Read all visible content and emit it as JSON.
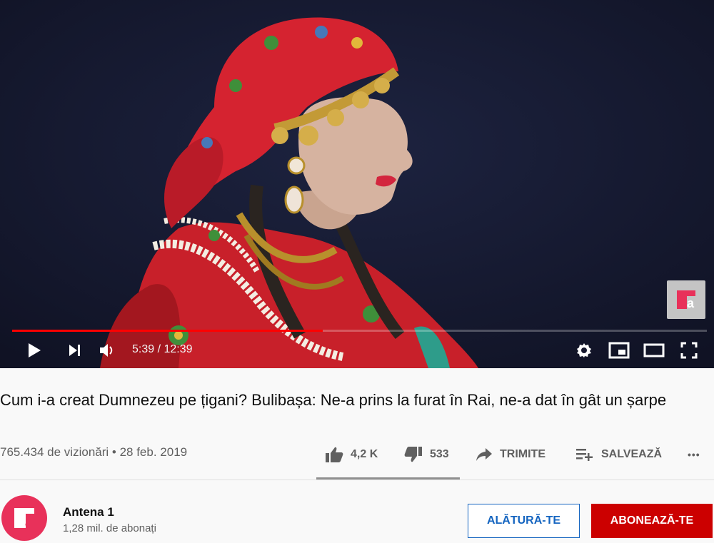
{
  "player": {
    "current_time": "5:39",
    "duration": "12:39",
    "time_separator": " / ",
    "progress_fraction": 0.447,
    "progress_color": "#ff0000",
    "watermark_icon": "antena1-logo-icon",
    "controls": [
      "play-icon",
      "next-icon",
      "volume-icon",
      "settings-icon",
      "miniplayer-icon",
      "theater-icon",
      "fullscreen-icon"
    ]
  },
  "video": {
    "title": "Cum i-a creat Dumnezeu pe țigani? Bulibașa: Ne-a prins la furat în Rai, ne-a dat în gât un șarpe",
    "views": "765.434 de vizionări",
    "dot": " • ",
    "date": "28 feb. 2019"
  },
  "actions": {
    "likes": "4,2 K",
    "dislikes": "533",
    "share_label": "TRIMITE",
    "save_label": "SALVEAZĂ",
    "more_label": "•••"
  },
  "channel": {
    "name": "Antena 1",
    "subscribers": "1,28 mil. de abonați",
    "avatar_color": "#e8315a",
    "join_label": "ALĂTURĂ-TE",
    "subscribe_label": "ABONEAZĂ-TE",
    "accent_blue": "#1565c0",
    "accent_red": "#cc0000"
  }
}
